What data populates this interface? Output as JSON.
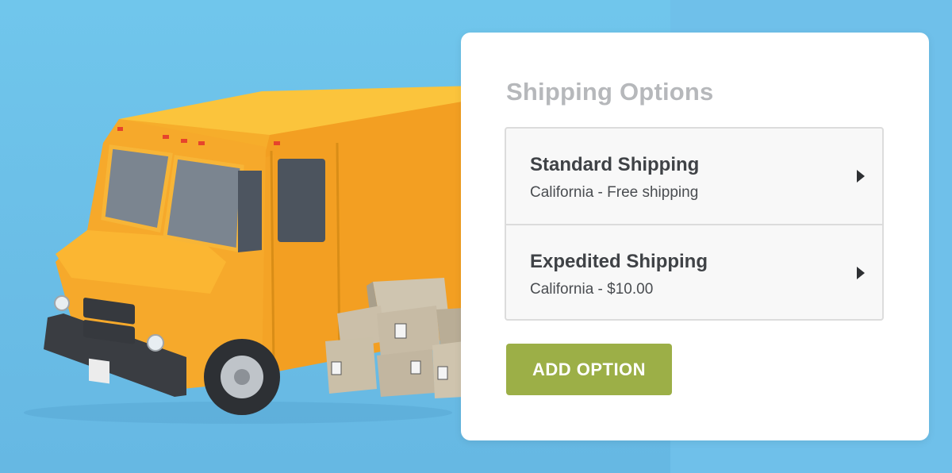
{
  "background": {
    "color": "#6cc1e9",
    "illustration": "delivery-van-with-boxes"
  },
  "shipping_card": {
    "title": "Shipping Options",
    "options": [
      {
        "name": "Standard Shipping",
        "description": "California - Free shipping",
        "icon": "chevron-right-icon"
      },
      {
        "name": "Expedited Shipping",
        "description": "California - $10.00",
        "icon": "chevron-right-icon"
      }
    ],
    "add_button_label": "ADD OPTION"
  },
  "colors": {
    "accent_button": "#9caf47",
    "title_text": "#b6b8bb",
    "van_body": "#f7a928"
  }
}
